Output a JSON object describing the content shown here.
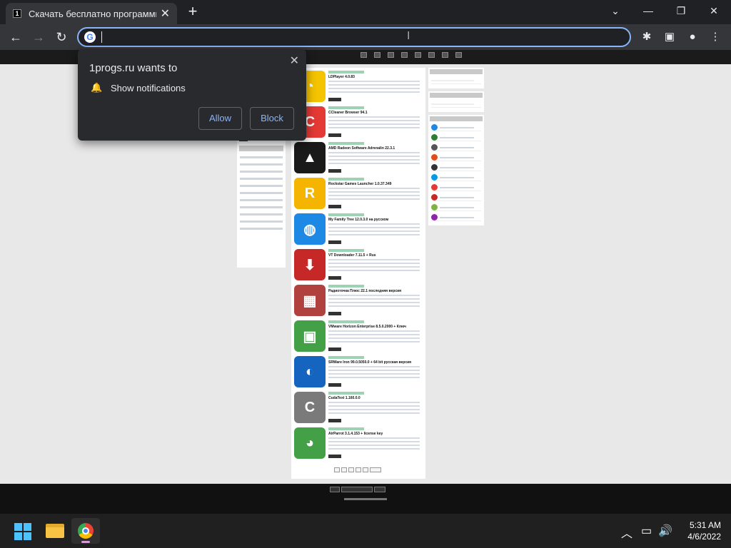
{
  "tab": {
    "title": "Скачать бесплатно программы",
    "close": "✕",
    "new_tab": "+"
  },
  "window": {
    "minimize": "⌄",
    "restore": "—",
    "maximize": "❐",
    "close": "✕"
  },
  "toolbar": {
    "back": "←",
    "forward": "→",
    "reload": "↻",
    "omnibox_value": "",
    "extensions": "✱",
    "side_panel": "▣",
    "profile": "●",
    "menu": "⋮"
  },
  "notification": {
    "title": "1progs.ru wants to",
    "permission": "Show notifications",
    "allow_label": "Allow",
    "block_label": "Block",
    "close": "✕"
  },
  "site": {
    "entries": [
      {
        "title": "LDPlayer 4.0.83",
        "color": "#f5c400",
        "glyph": "◔"
      },
      {
        "title": "CCleaner Browser 94.1",
        "color": "#e53935",
        "glyph": "C"
      },
      {
        "title": "AMD Radeon Software Adrenalin 22.3.1",
        "color": "#1a1a1a",
        "glyph": "▲"
      },
      {
        "title": "Rockstar Games Launcher 1.0.37.349",
        "color": "#f4b400",
        "glyph": "R"
      },
      {
        "title": "My Family Tree 12.0.3.0 на русском",
        "color": "#1e88e5",
        "glyph": "◍"
      },
      {
        "title": "VT Downloader 7.11.5 + Rus",
        "color": "#c62828",
        "glyph": "⬇"
      },
      {
        "title": "Радиоточка Плюс 22.1 последняя версия",
        "color": "#b0413e",
        "glyph": "▦"
      },
      {
        "title": "VMware Horizon Enterprise 8.5.0.2000 + Ключ",
        "color": "#43a047",
        "glyph": "▣"
      },
      {
        "title": "SRWare Iron 99.0.5050.0 + 64 bit русская версия",
        "color": "#1565c0",
        "glyph": "◐"
      },
      {
        "title": "CudaText 1.160.0.0",
        "color": "#7a7a7a",
        "glyph": "C"
      },
      {
        "title": "AirParrot 3.1.4.153 + license key",
        "color": "#43a047",
        "glyph": "◕"
      }
    ]
  },
  "taskbar": {
    "time": "5:31 AM",
    "date": "4/6/2022",
    "chevron": "︿",
    "network": "▭",
    "volume": "🔊"
  }
}
